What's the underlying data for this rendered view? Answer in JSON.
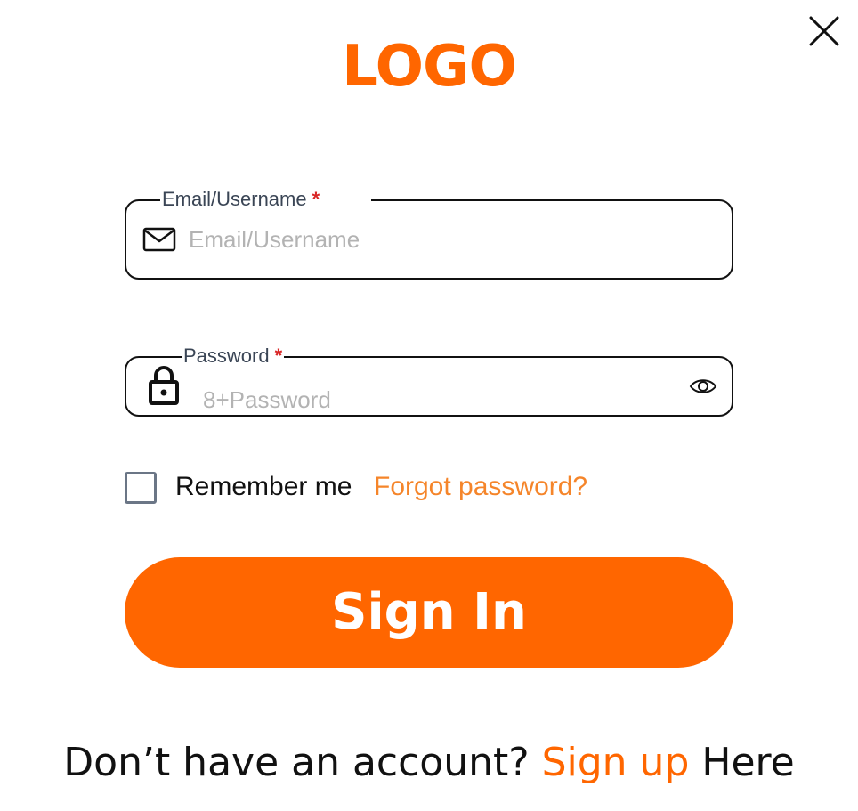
{
  "brand": {
    "logo_text": "LOGO",
    "accent_color": "#FF6600",
    "link_color": "#F5852A"
  },
  "close": {
    "icon": "close-icon"
  },
  "email_field": {
    "label": "Email/Username",
    "required_mark": "*",
    "placeholder": "Email/Username",
    "value": "",
    "icon": "mail-icon"
  },
  "password_field": {
    "label": "Password",
    "required_mark": "*",
    "placeholder": "8+Password",
    "value": "",
    "icon": "lock-icon",
    "toggle_icon": "eye-icon"
  },
  "remember": {
    "label": "Remember me",
    "checked": false
  },
  "forgot_password": {
    "label": "Forgot password?"
  },
  "submit": {
    "label": "Sign In"
  },
  "footer": {
    "prefix": "Don’t have an account? ",
    "link": "Sign up",
    "suffix": " Here"
  }
}
